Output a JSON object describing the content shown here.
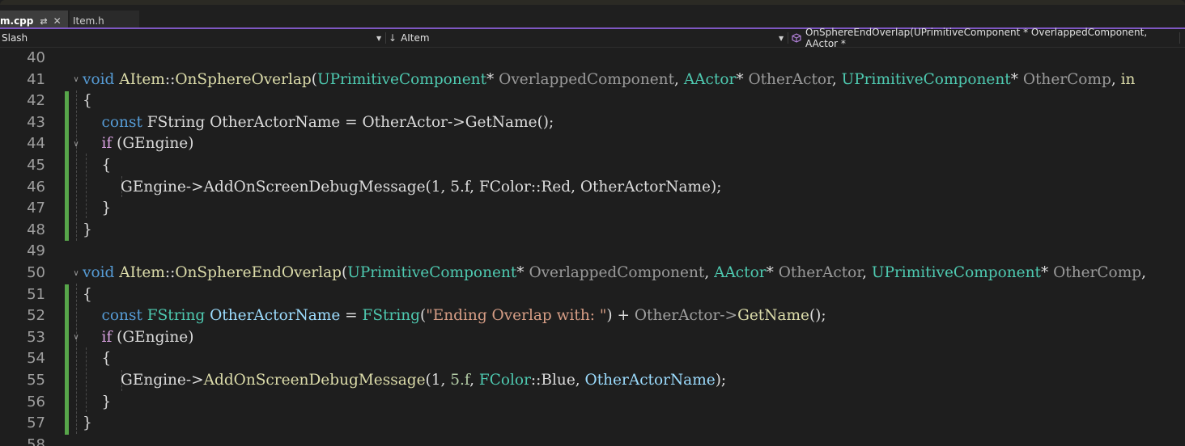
{
  "tabs": [
    {
      "label": "m.cpp",
      "active": true
    },
    {
      "label": "Item.h",
      "active": false
    }
  ],
  "icons": {
    "pin": "pin-icon",
    "close": "close-icon",
    "arrow": "down-arrow-icon",
    "method": "method-cube-icon"
  },
  "nav": {
    "project": "Slash",
    "class": "AItem",
    "member": "OnSphereEndOverlap(UPrimitiveComponent * OverlappedComponent, AActor *"
  },
  "colors": {
    "accent": "#7e57c2",
    "change_bar": "#57a64a",
    "keyword": "#569cd6",
    "control_keyword": "#d8a0df",
    "type": "#4ec9b0",
    "function": "#dcdcaa",
    "string": "#d69d85",
    "number": "#b5cea8"
  },
  "editor": {
    "line_numbers": [
      "40",
      "41",
      "42",
      "43",
      "44",
      "45",
      "46",
      "47",
      "48",
      "49",
      "50",
      "51",
      "52",
      "53",
      "54",
      "55",
      "56",
      "57",
      "58"
    ],
    "lines": [
      [],
      [
        [
          "kw",
          "void"
        ],
        [
          "plain",
          " "
        ],
        [
          "fn",
          "AItem"
        ],
        [
          "plain",
          "::"
        ],
        [
          "fn",
          "OnSphereOverlap"
        ],
        [
          "plain",
          "("
        ],
        [
          "type",
          "UPrimitiveComponent"
        ],
        [
          "plain",
          "* "
        ],
        [
          "param",
          "OverlappedComponent"
        ],
        [
          "plain",
          ", "
        ],
        [
          "type",
          "AActor"
        ],
        [
          "plain",
          "* "
        ],
        [
          "param",
          "OtherActor"
        ],
        [
          "plain",
          ", "
        ],
        [
          "type",
          "UPrimitiveComponent"
        ],
        [
          "plain",
          "* "
        ],
        [
          "param",
          "OtherComp"
        ],
        [
          "plain",
          ", "
        ],
        [
          "fn",
          "in"
        ]
      ],
      [
        [
          "plain",
          "{"
        ]
      ],
      [
        [
          "plain",
          "    "
        ],
        [
          "kw",
          "const"
        ],
        [
          "plain",
          " FString OtherActorName = OtherActor->GetName();"
        ]
      ],
      [
        [
          "plain",
          "    "
        ],
        [
          "kw2",
          "if"
        ],
        [
          "plain",
          " (GEngine)"
        ]
      ],
      [
        [
          "plain",
          "    {"
        ]
      ],
      [
        [
          "plain",
          "        GEngine->AddOnScreenDebugMessage(1, 5.f, FColor::Red, OtherActorName);"
        ]
      ],
      [
        [
          "plain",
          "    }"
        ]
      ],
      [
        [
          "plain",
          "}"
        ]
      ],
      [],
      [
        [
          "kw",
          "void"
        ],
        [
          "plain",
          " "
        ],
        [
          "fn",
          "AItem"
        ],
        [
          "plain",
          "::"
        ],
        [
          "fn",
          "OnSphereEndOverlap"
        ],
        [
          "plain",
          "("
        ],
        [
          "type",
          "UPrimitiveComponent"
        ],
        [
          "plain",
          "* "
        ],
        [
          "param",
          "OverlappedComponent"
        ],
        [
          "plain",
          ", "
        ],
        [
          "type",
          "AActor"
        ],
        [
          "plain",
          "* "
        ],
        [
          "param",
          "OtherActor"
        ],
        [
          "plain",
          ", "
        ],
        [
          "type",
          "UPrimitiveComponent"
        ],
        [
          "plain",
          "* "
        ],
        [
          "param",
          "OtherComp"
        ],
        [
          "plain",
          ","
        ]
      ],
      [
        [
          "plain",
          "{"
        ]
      ],
      [
        [
          "plain",
          "    "
        ],
        [
          "kw",
          "const"
        ],
        [
          "plain",
          " "
        ],
        [
          "type",
          "FString"
        ],
        [
          "plain",
          " "
        ],
        [
          "var",
          "OtherActorName"
        ],
        [
          "plain",
          " = "
        ],
        [
          "type",
          "FString"
        ],
        [
          "plain",
          "("
        ],
        [
          "str",
          "\"Ending Overlap with: \""
        ],
        [
          "plain",
          ") + "
        ],
        [
          "dim",
          "OtherActor->"
        ],
        [
          "fn",
          "GetName"
        ],
        [
          "plain",
          "();"
        ]
      ],
      [
        [
          "plain",
          "    "
        ],
        [
          "kw2",
          "if"
        ],
        [
          "plain",
          " (GEngine)"
        ]
      ],
      [
        [
          "plain",
          "    {"
        ]
      ],
      [
        [
          "plain",
          "        GEngine->"
        ],
        [
          "fn",
          "AddOnScreenDebugMessage"
        ],
        [
          "plain",
          "(1, "
        ],
        [
          "num",
          "5.f"
        ],
        [
          "plain",
          ", "
        ],
        [
          "type",
          "FColor"
        ],
        [
          "plain",
          "::Blue, "
        ],
        [
          "var",
          "OtherActorName"
        ],
        [
          "plain",
          ");"
        ]
      ],
      [
        [
          "plain",
          "    }"
        ]
      ],
      [
        [
          "plain",
          "}"
        ]
      ],
      []
    ]
  }
}
